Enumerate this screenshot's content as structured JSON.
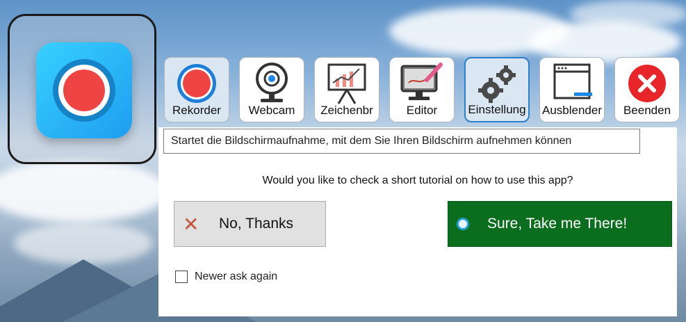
{
  "toolbar": {
    "buttons": [
      {
        "label": "Rekorder",
        "icon": "record-icon"
      },
      {
        "label": "Webcam",
        "icon": "webcam-icon"
      },
      {
        "label": "Zeichenbr",
        "icon": "whiteboard-chart-icon"
      },
      {
        "label": "Editor",
        "icon": "monitor-pen-icon"
      },
      {
        "label": "Einstellung",
        "icon": "gears-icon"
      },
      {
        "label": "Ausblender",
        "icon": "hide-window-icon"
      },
      {
        "label": "Beenden",
        "icon": "close-circle-icon"
      }
    ]
  },
  "tooltip": "Startet die Bildschirmaufnahme, mit dem Sie Ihren Bildschirm aufnehmen können",
  "dialog": {
    "question": "Would you like to check a short tutorial on how to use this app?",
    "no_button": "No, Thanks",
    "yes_button": "Sure, Take me There!",
    "checkbox_label": "Newer ask again"
  },
  "colors": {
    "accent_blue": "#2c7fc8",
    "record_red": "#ef4444",
    "confirm_green": "#0b6e1e",
    "close_red": "#e8262a"
  }
}
